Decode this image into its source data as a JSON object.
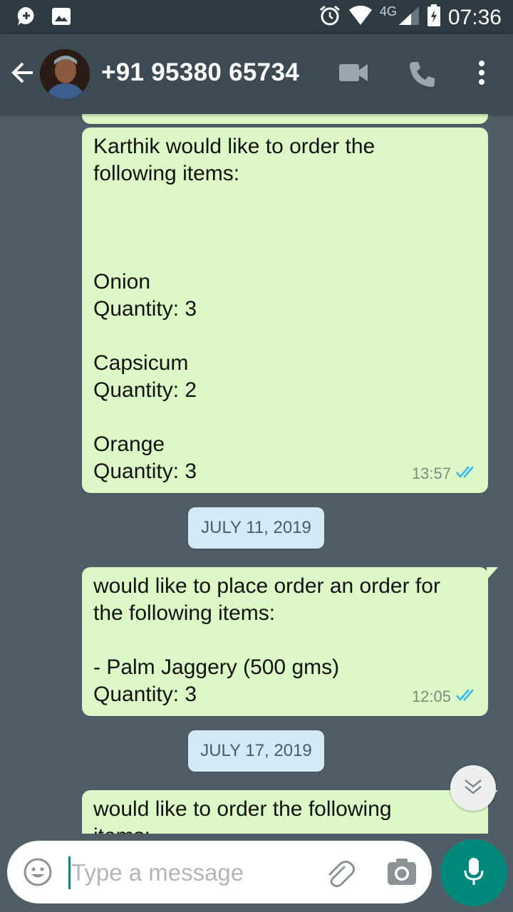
{
  "status_bar": {
    "network": "4G",
    "time": "07:36"
  },
  "header": {
    "contact_name": "+91 95380 65734"
  },
  "messages": [
    {
      "lines": [
        "Karthik would like to order the",
        "following items:",
        "",
        "",
        "",
        "Onion",
        "Quantity: 3",
        "",
        "Capsicum",
        "Quantity: 2",
        "",
        "Orange",
        "Quantity: 3"
      ],
      "time": "13:57",
      "status": "read"
    },
    {
      "lines": [
        "would like to place order an order for",
        "the following items:",
        "",
        "- Palm Jaggery (500 gms)",
        "Quantity: 3"
      ],
      "time": "12:05",
      "status": "read"
    },
    {
      "lines": [
        "would like to order the following",
        "items:"
      ],
      "time": "",
      "status": "read"
    }
  ],
  "date_separators": [
    "JULY 11, 2019",
    "JULY 17, 2019"
  ],
  "composer": {
    "placeholder": "Type a message"
  },
  "colors": {
    "header": "#3c4a53",
    "outgoing_bubble": "#dcf8c6",
    "date_chip": "#d4e9f6",
    "accent": "#00897b",
    "read_ticks": "#34b7f1"
  }
}
